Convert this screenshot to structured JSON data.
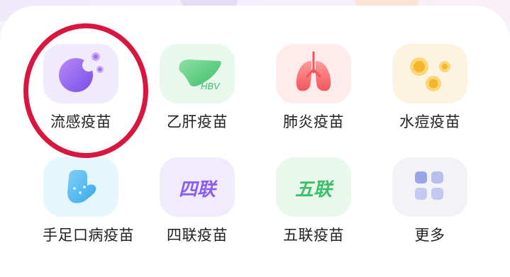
{
  "menu": {
    "items": [
      {
        "label": "流感疫苗",
        "icon": "flu-vaccine-icon",
        "bg": "#efebfd"
      },
      {
        "label": "乙肝疫苗",
        "icon": "hepatitis-b-liver-icon",
        "bg": "#e8f8ec",
        "badge": "HBV"
      },
      {
        "label": "肺炎疫苗",
        "icon": "lungs-icon",
        "bg": "#fdeceb"
      },
      {
        "label": "水痘疫苗",
        "icon": "chickenpox-icon",
        "bg": "#fdf3e1"
      },
      {
        "label": "手足口病疫苗",
        "icon": "hand-foot-mouth-icon",
        "bg": "#e5f6fc"
      },
      {
        "label": "四联疫苗",
        "icon": "quadruple-vaccine-icon",
        "bg": "#f1ecfc",
        "badge": "四联"
      },
      {
        "label": "五联疫苗",
        "icon": "pentavalent-vaccine-icon",
        "bg": "#e8f8ec",
        "badge": "五联"
      },
      {
        "label": "更多",
        "icon": "more-grid-icon",
        "bg": "#f2f2f7"
      }
    ]
  },
  "highlight": {
    "color": "#d8163f"
  }
}
